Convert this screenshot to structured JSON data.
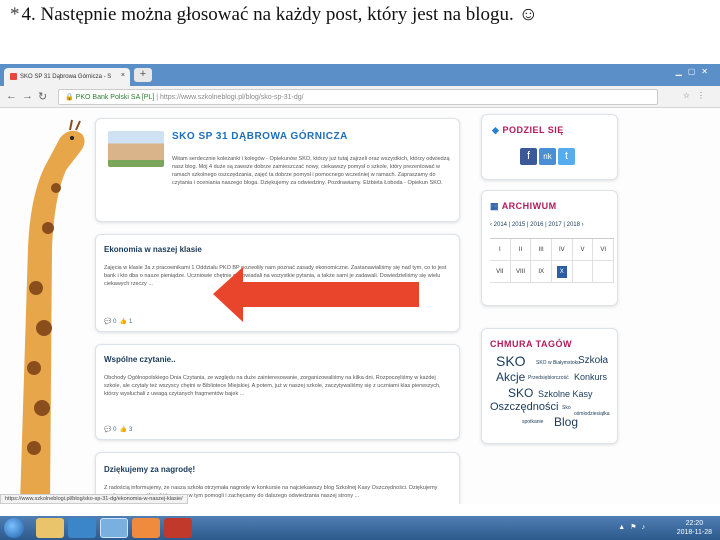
{
  "slide": {
    "bullet": "*",
    "title": "4. Następnie można głosować  na każdy post, który jest na blogu. ",
    "smiley": "☺"
  },
  "browser": {
    "tab_title": "SKO SP 31 Dąbrowa Górnicza - S",
    "tab_close": "×",
    "new_tab": "+",
    "address_secure": "PKO Bank Polski SA [PL]",
    "address_url": "https://www.szkolneblogi.pl/blog/sko-sp-31-dg/",
    "status_url": "https://www.szkolneblogi.pl/blog/sko-sp-31-dg/ekonomia-w-naszej-klasie/"
  },
  "school": {
    "title": "SKO SP 31 DĄBROWA GÓRNICZA",
    "body": "Witam serdecznie koleżanki i kolegów - Opiekunów SKO, którzy już tutaj zajrzeli oraz wszystkich, którzy odwiedzą nasz blog. Mój 4 duże są zawsze dobrze zamieszczać nowy, ciekawszy pomysł o szkole, który prezentować w ramach szkolnego oszczędzania, zajęć ta dobrze pomysł i pomocnego wcześniej w ramach. Zapraszamy do czytania i oceniania naszego bloga. Dziękujemy za odwiedziny. Pozdrawiamy. Elżbieta Łoboda - Opiekun SKO."
  },
  "posts": [
    {
      "title": "Ekonomia w naszej klasie",
      "body": "Zajęcia w klasie 3a z pracownikami 1 Oddziału PKO BP pozwoliły nam poznać zasady ekonomiczne. Zastanawialiśmy się nad tym, co to jest bank i kto dba o nasze pieniądze. Uczniowie chętnie odpowiadali na wszystkie pytania, a także sami je zadawali. Dowiedzieliśmy się wielu ciekawych rzeczy ...",
      "comments": "0",
      "likes": "1"
    },
    {
      "title": "Wspólne czytanie..",
      "body": "Obchody Ogólnopolskiego Dnia Czytania, ze względu na duże zainteresowanie, zorganizowaliśmy na kilka dni. Rozpoczęliśmy w każdej szkole, ale czytały też wszyscy chętni w Bibliotece Miejskiej. A potem, już w naszej szkole, zaczytywaliśmy się z uczniami klas pierwszych, którzy wysłuchali z uwagą czytanych fragmentów bajek ...",
      "comments": "0",
      "likes": "3"
    },
    {
      "title": "Dziękujemy za nagrodę!",
      "body": "Z radością informujemy, że nasza szkoła otrzymała nagrodę w konkursie na najciekawszy blog Szkolnej Kasy Oszczędności. Dziękujemy serdecznie wszystkim, którzy nam w tym pomogli i zachęcamy do dalszego odwiedzania naszej strony ..."
    }
  ],
  "share": {
    "title": "PODZIEL SIĘ",
    "icons": [
      "f",
      "nk",
      "t"
    ]
  },
  "archive": {
    "title": "ARCHIWUM",
    "years": "2014 | 2015 | 2016 | 2017 | 2018",
    "prev": "‹",
    "next": "›",
    "months": [
      "I",
      "II",
      "III",
      "IV",
      "V",
      "VI",
      "VII",
      "VIII",
      "IX",
      "X",
      "",
      ""
    ]
  },
  "tags": {
    "title": "CHMURA TAGÓW",
    "items": [
      "SKO",
      "SKO w Białymstoku",
      "Szkoła",
      "Akcje",
      "Przedsiębiorczość",
      "Konkurs",
      "SKO",
      "Szkolne Kasy",
      "Oszczędności",
      "Sko",
      "ośmiodziesiątka",
      "spotkanie",
      "Blog"
    ]
  },
  "taskbar": {
    "clock_time": "22:20",
    "clock_date": "2018-11-28"
  },
  "colors": {
    "arrow": "#e8452c",
    "facebook": "#3b5998",
    "nk": "#4a8fd3",
    "twitter": "#55acee",
    "accent": "#b01c5b",
    "school_title": "#1d6fb8"
  }
}
